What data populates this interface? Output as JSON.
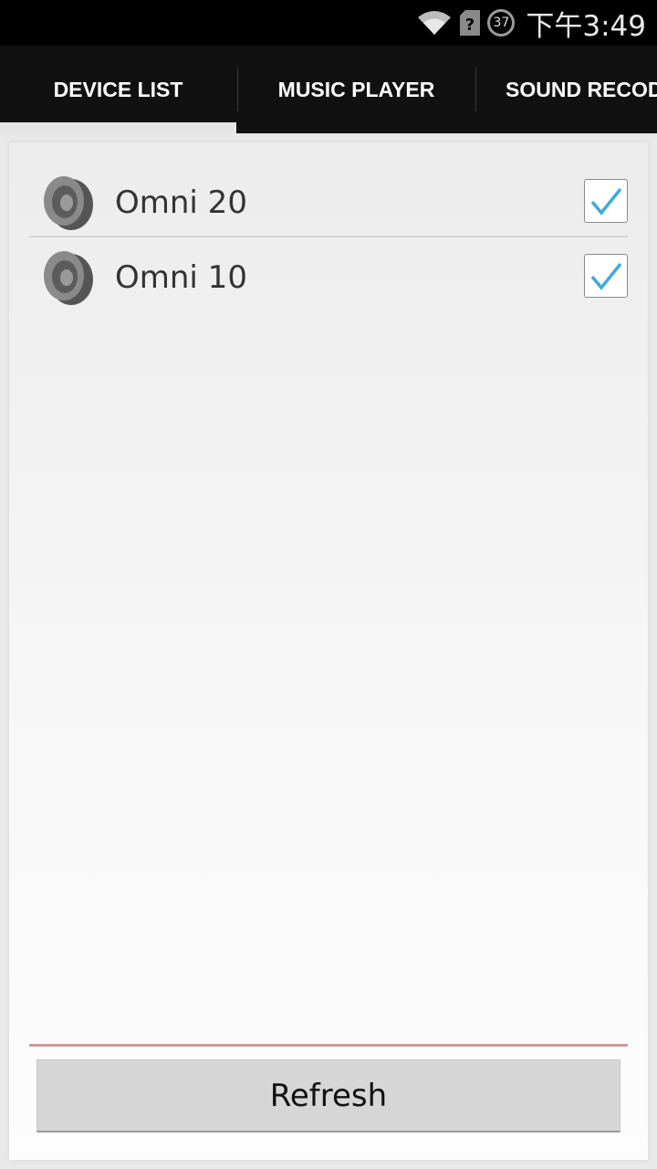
{
  "status_bar": {
    "battery_level": "37",
    "time": "下午3:49",
    "icons": [
      "wifi-icon",
      "sim-unknown-icon",
      "battery-icon"
    ]
  },
  "tabs": [
    {
      "label": "DEVICE LIST",
      "active": true
    },
    {
      "label": "MUSIC PLAYER",
      "active": false
    },
    {
      "label": "SOUND RECOD",
      "active": false
    }
  ],
  "devices": [
    {
      "name": "Omni 20",
      "checked": true,
      "icon": "speaker-icon"
    },
    {
      "name": "Omni 10",
      "checked": true,
      "icon": "speaker-icon"
    }
  ],
  "refresh_label": "Refresh",
  "colors": {
    "accent_check": "#3fa9e0",
    "accent_line": "#d19a9a",
    "tab_bar_bg": "#111111"
  }
}
